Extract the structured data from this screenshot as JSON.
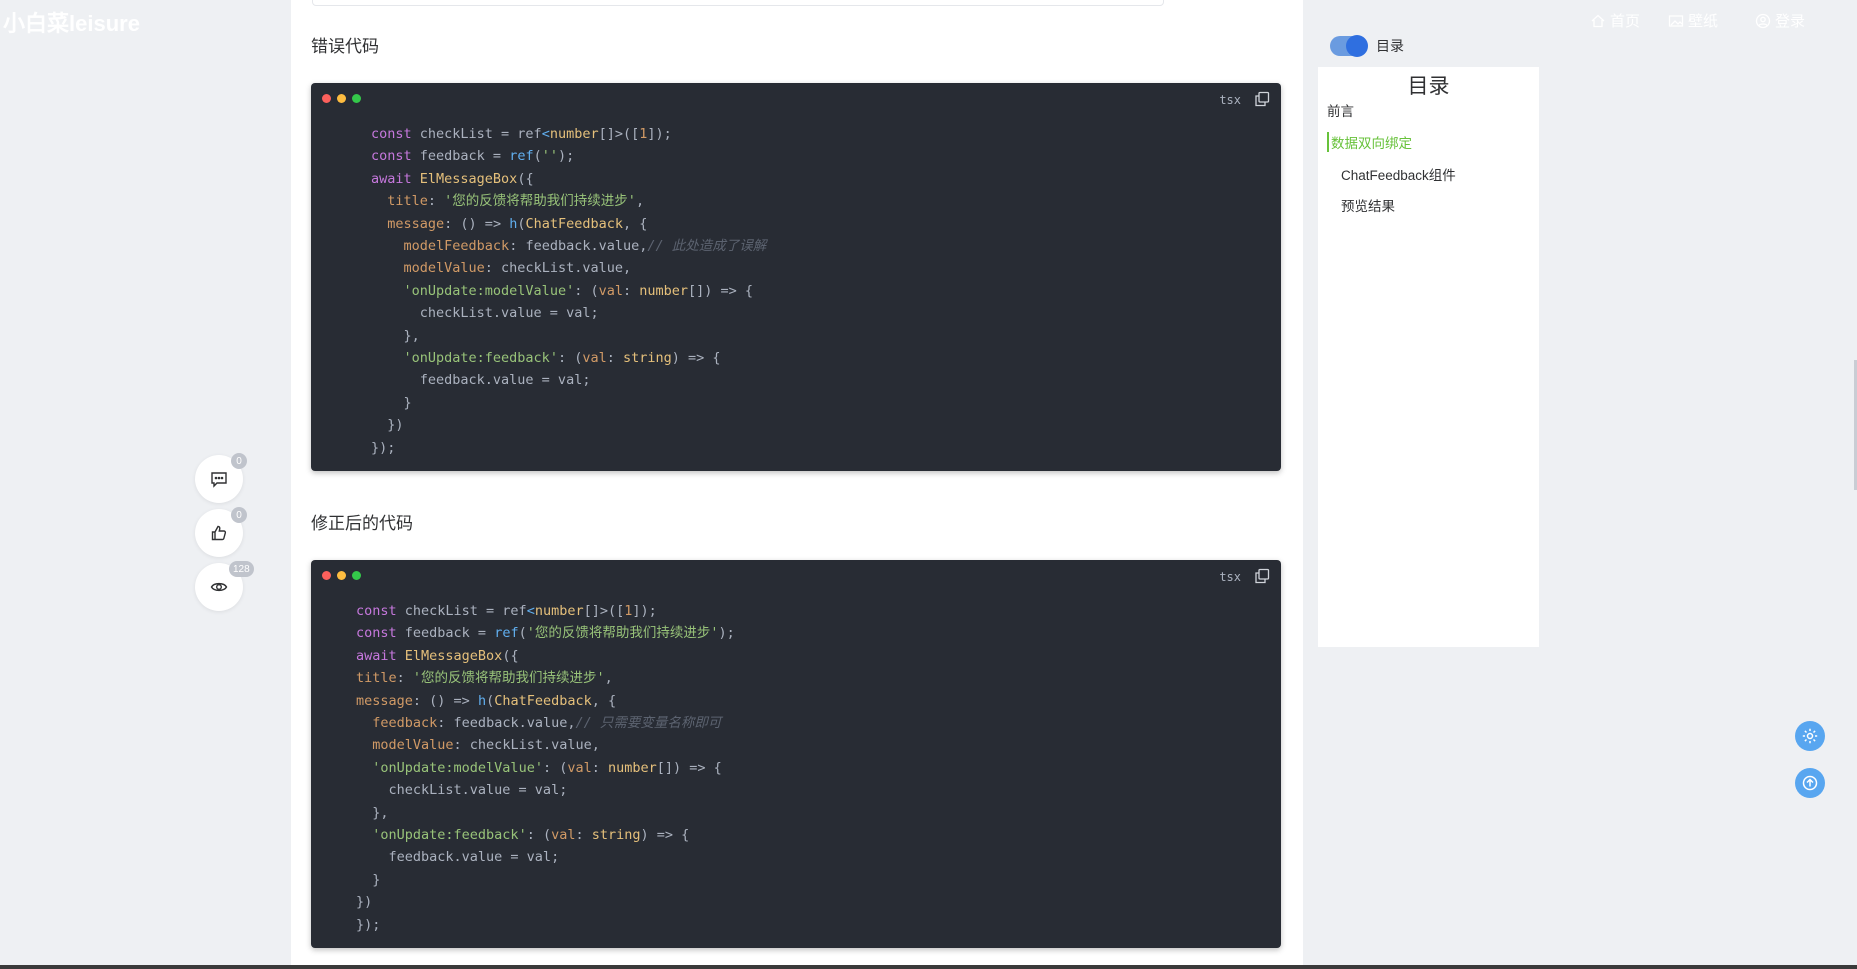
{
  "nav": {
    "logo": "小白菜leisure",
    "links": [
      {
        "label": "首页",
        "icon": "home-icon"
      },
      {
        "label": "壁纸",
        "icon": "image-icon"
      },
      {
        "label": "登录",
        "icon": "user-icon"
      }
    ]
  },
  "article": {
    "heading_wrong": "错误代码",
    "heading_fixed": "修正后的代码",
    "code_wrong": {
      "lang": "tsx",
      "lines": [
        "const checkList = ref<number[]>([1]);",
        "const feedback = ref('');",
        "await ElMessageBox({",
        "  title: '您的反馈将帮助我们持续进步',",
        "  message: () => h(ChatFeedback, {",
        "    modelFeedback: feedback.value,// 此处造成了误解",
        "    modelValue: checkList.value,",
        "    'onUpdate:modelValue': (val: number[]) => {",
        "      checkList.value = val;",
        "    },",
        "    'onUpdate:feedback': (val: string) => {",
        "      feedback.value = val;",
        "    }",
        "  })",
        "});"
      ]
    },
    "code_fixed": {
      "lang": "tsx",
      "lines": [
        "const checkList = ref<number[]>([1]);",
        "const feedback = ref('您的反馈将帮助我们持续进步');",
        "await ElMessageBox({",
        "title: '您的反馈将帮助我们持续进步',",
        "message: () => h(ChatFeedback, {",
        "  feedback: feedback.value,// 只需要变量名称即可",
        "  modelValue: checkList.value,",
        "  'onUpdate:modelValue': (val: number[]) => {",
        "    checkList.value = val;",
        "  },",
        "  'onUpdate:feedback': (val: string) => {",
        "    feedback.value = val;",
        "  }",
        "})",
        "});"
      ]
    }
  },
  "actions": {
    "comments": {
      "count": "0",
      "icon": "comment-icon"
    },
    "likes": {
      "count": "0",
      "icon": "thumbs-up-icon"
    },
    "views": {
      "count": "128",
      "icon": "eye-icon"
    }
  },
  "toc": {
    "switch_label": "目录",
    "switch_on": true,
    "title": "目录",
    "items": [
      {
        "label": "前言",
        "active": false
      },
      {
        "label": "数据双向绑定",
        "active": true
      },
      {
        "label": "ChatFeedback组件",
        "active": false
      },
      {
        "label": "预览结果",
        "active": false
      }
    ]
  },
  "side_buttons": [
    {
      "icon": "gear-icon"
    },
    {
      "icon": "arrow-up-icon"
    }
  ],
  "colors": {
    "accent": "#58a6f0",
    "toc_active": "#67c23a",
    "code_bg": "#282c34"
  }
}
